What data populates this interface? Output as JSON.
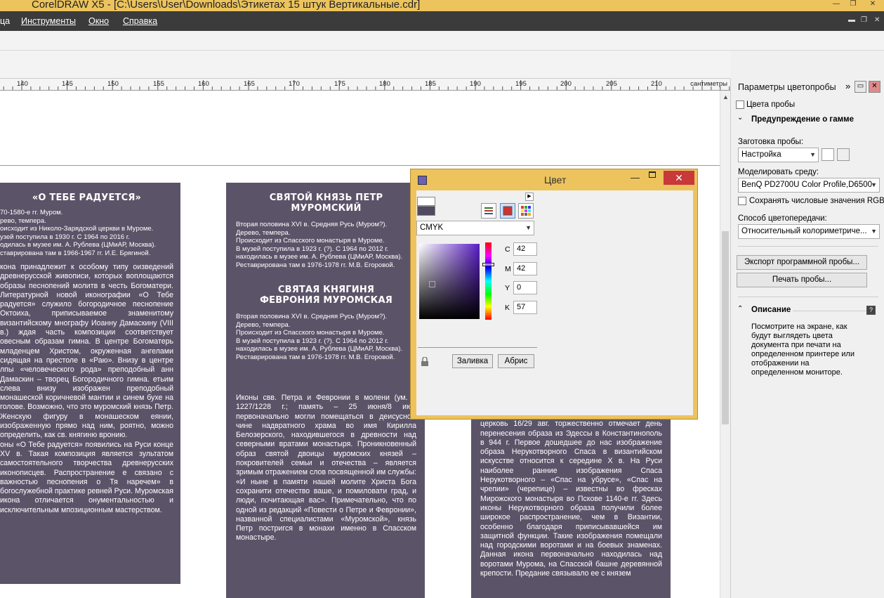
{
  "app": {
    "title": "CorelDRAW X5 - [C:\\Users\\User\\Downloads\\Этикетах 15 штук Вертикальные.cdr]"
  },
  "menu": {
    "items": [
      {
        "label": "ца"
      },
      {
        "label": "Инструменты"
      },
      {
        "label": "Окно"
      },
      {
        "label": "Справка"
      }
    ]
  },
  "ruler": {
    "ticks": [
      "140",
      "145",
      "150",
      "155",
      "160",
      "165",
      "170",
      "175",
      "180",
      "185",
      "190",
      "195",
      "200",
      "205",
      "210"
    ],
    "unit": "сантиметры"
  },
  "labels": {
    "left": {
      "title": "«О ТЕБЕ РАДУЕТСЯ»",
      "meta": [
        "70-1580-е гг. Муром.",
        "рево, темпера.",
        "оисходит из Николо-Зарядской церкви в Муроме.",
        "узей поступила в 1930 г. С 1964 по 2016 г.",
        "одилась в музее им. А. Рублева (ЦМиАР, Москва).",
        "ставрирована там в 1966-1967 гг. И.Е. Брягиной."
      ],
      "body1": "кона принадлежит к особому типу оизведений древнерусской живописи, которых воплощаются образы песнопений молитв в честь Богоматери. Литературной новой иконографии «О Тебе радуется» служило богородичное песнопение Октоиха, приписываемое знаменитому византийскому мнографу Иоанну Дамаскину (VIII в.) ждая часть композиции соответствует овесным образам гимна. В центре Богоматерь младенцем Христом, окруженная ангелами сидящая на престоле в «Раю». Внизу в центре лпы «человеческого рода» преподобный анн Дамаскин – творец Богородичного гимна. етьим слева внизу изображен преподобный монашеской коричневой мантии и синем бухе на голове. Возможно, что это муромский князь Петр. Женскую фигуру в монашеском еянии, изображенную прямо над ним, роятно, можно определить, как св. княгиню вронию.",
      "body2": "оны «О Тебе радуется» появились на Руси конце XV в. Такая композиция является зультатом самостоятельного творчества древнерусских иконописцев. Распространение е связано с важностью песнопения о Тя наречем» в богослужебной практике ревней Руси. Муромская икона отличается онументальностью и исключительным мпозиционным мастерством."
    },
    "middle": {
      "title1": "СВЯТОЙ КНЯЗЬ ПЕТР МУРОМСКИЙ",
      "meta1": [
        "Вторая половина XVI в. Средняя Русь (Муром?).",
        "Дерево, темпера.",
        "Происходит из Спасского монастыря в Муроме.",
        "В музей поступила в 1923 г. (?). С 1964 по 2012 г.",
        "находилась в музее им. А. Рублева (ЦМиАР, Москва).",
        "Реставрирована там в 1976-1978 гг. М.В. Егоровой."
      ],
      "title2": "СВЯТАЯ КНЯГИНЯ ФЕВРОНИЯ МУРОМСКАЯ",
      "meta2": [
        "Вторая половина XVI в. Средняя Русь (Муром?).",
        "Дерево, темпера.",
        "Происходит из Спасского монастыря в Муроме.",
        "В музей поступила в 1923 г. (?). С 1964 по 2012 г.",
        "находилась в музее им. А. Рублева (ЦМиАР, Москва).",
        "Реставрирована там в 1976-1978 гг. М.В. Егоровой."
      ],
      "body": "Иконы свв. Петра и Февронии в молени (ум. в 1227/1228 г.; память – 25 июня/8 июл первоначально могли помещаться в деисусном чине надвратного храма во имя Кирилла Белозерского, находившегося в древности над северными вратами монастыря. Проникновенный образ святой двоицы муромских князей – покровителей семьи и отечества – является зримым отражением слов посвященной им службы: «И ныне в памяти нашей молите Христа Бога сохранити отечество ваше, и помиловати град, и люди, почитающая вас». Примечательно, что по одной из редакций «Повести о Петре и Февронии», названной специалистами «Муромской», князь Петр постригся в монахи именно в Спасском монастыре."
    },
    "right": {
      "body": "Авгаре была известна с XI в. Православная церковь 16/29 авг. торжественно отмечает день перенесения образа из Эдессы в Константинополь в 944 г. Первое дошедшее до нас изображение образа Нерукотворного Спаса в византийском искусстве относится к середине X в. На Руси наиболее ранние изображения Спаса Нерукотворного – «Спас на убрусе», «Спас на чрепии» (черепице) – известны во фресках Мирожского монастыря во Пскове 1140-е гг. Здесь иконы Нерукотворного образа получили более широкое распространение, чем в Византии, особенно благодаря приписывавшейся им защитной функции. Такие изображения помещали над городскими воротами и на боевых знаменах. Данная икона первоначально находилась над воротами Мурома, на Спасской башне деревянной крепости. Предание связывало ее с князем"
    }
  },
  "color_dialog": {
    "title": "Цвет",
    "model": "CMYK",
    "channels": [
      {
        "name": "C",
        "value": "42"
      },
      {
        "name": "M",
        "value": "42"
      },
      {
        "name": "Y",
        "value": "0"
      },
      {
        "name": "K",
        "value": "57"
      }
    ],
    "fill_button": "Заливка",
    "outline_button": "Абрис",
    "current_color": "#4f4a60",
    "new_color": "#ffffff"
  },
  "docker": {
    "title": "Параметры цветопробы",
    "proof_colors": "Цвета пробы",
    "gamut_warning": "Предупреждение о гамме",
    "preset_label": "Заготовка пробы:",
    "preset_value": "Настройка",
    "simulate_label": "Моделировать среду:",
    "simulate_value": "BenQ PD2700U Color Profile,D6500",
    "preserve_rgb": "Сохранять числовые значения RGB",
    "rendering_label": "Способ цветопередачи:",
    "rendering_value": "Относительный колориметриче...",
    "export_button": "Экспорт программной пробы...",
    "print_button": "Печать пробы...",
    "description_header": "Описание",
    "description_text": "Посмотрите на экране, как будут выглядеть цвета документа при печати на определенном принтере или отображении на определенном мониторе."
  }
}
